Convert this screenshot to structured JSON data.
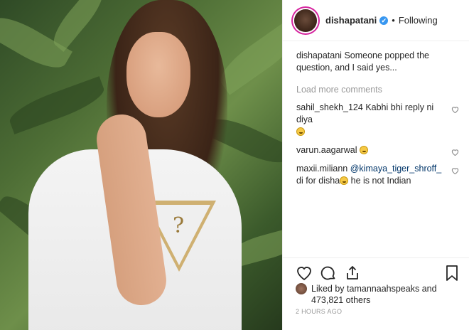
{
  "post": {
    "author": "dishapatani",
    "verified_badge": "✔",
    "dot": "•",
    "follow_status": "Following",
    "caption_user": "dishapatani",
    "caption_text": "Someone popped the question, and I said yes..."
  },
  "load_more": "Load more comments",
  "comments": [
    {
      "user": "sahil_shekh_124",
      "text": "Kabhi bhi reply ni diya",
      "emoji": "grinning"
    },
    {
      "user": "varun.aagarwal",
      "text": "",
      "emoji": "grinning"
    },
    {
      "user": "maxii.miliann",
      "mention": "@kimaya_tiger_shroff_",
      "text_a": "di for disha",
      "text_b": "he is not Indian",
      "emoji": "smiling"
    }
  ],
  "likes": {
    "prefix": "Liked by",
    "user": "tamannaahspeaks",
    "and": "and",
    "count": "473,821 others"
  },
  "time": "2 HOURS AGO",
  "photo": {
    "shirt_logo": "?"
  },
  "icons": [
    "heart-icon",
    "comment-icon",
    "share-icon",
    "bookmark-icon",
    "small-heart-icon",
    "verified-icon"
  ],
  "colors": {
    "verified": "#3897f0",
    "ring": "#d6249f",
    "muted": "#999999"
  }
}
